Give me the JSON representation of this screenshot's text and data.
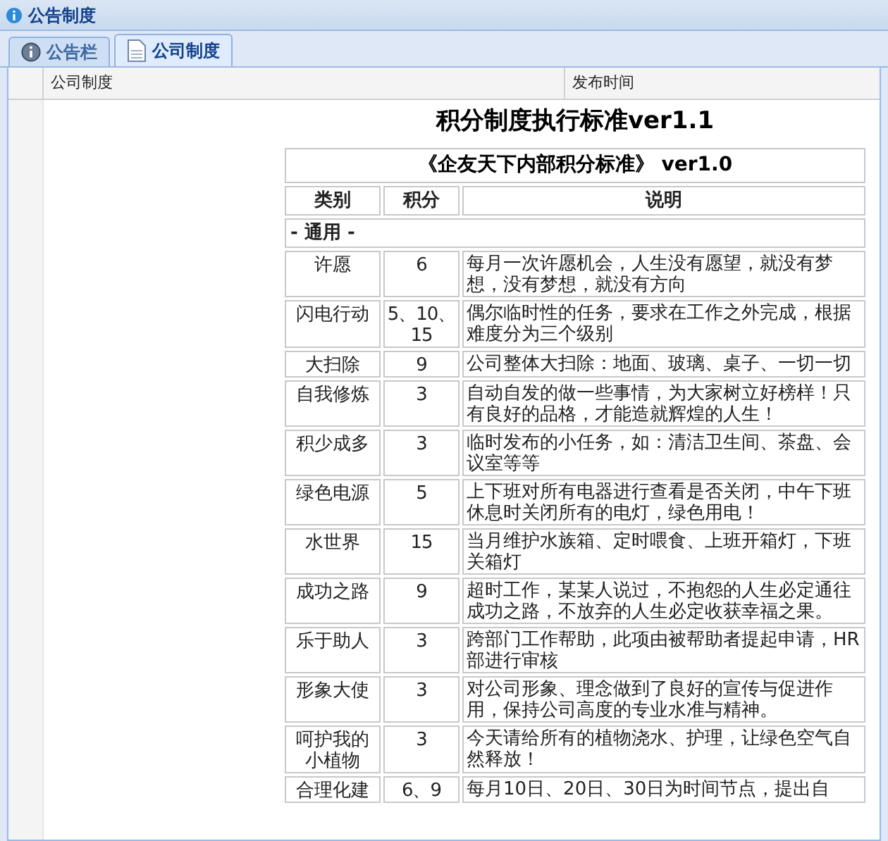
{
  "window": {
    "title": "公告制度"
  },
  "tabs": [
    {
      "label": "公告栏",
      "selected": false
    },
    {
      "label": "公司制度",
      "selected": true
    }
  ],
  "grid": {
    "columns": [
      "公司制度",
      "发布时间"
    ]
  },
  "document": {
    "title": "积分制度执行标准ver1.1",
    "subtitle": "《企友天下内部积分标准》 ver1.0",
    "columns": [
      "类别",
      "积分",
      "说明"
    ],
    "sections": [
      {
        "name": "- 通用 -",
        "rows": [
          {
            "category": "许愿",
            "points": "6",
            "description": "每月一次许愿机会，人生没有愿望，就没有梦想，没有梦想，就没有方向"
          },
          {
            "category": "闪电行动",
            "points": "5、10、15",
            "description": "偶尔临时性的任务，要求在工作之外完成，根据难度分为三个级别"
          },
          {
            "category": "大扫除",
            "points": "9",
            "description": "公司整体大扫除：地面、玻璃、桌子、一切一切"
          },
          {
            "category": "自我修炼",
            "points": "3",
            "description": "自动自发的做一些事情，为大家树立好榜样！只有良好的品格，才能造就辉煌的人生！"
          },
          {
            "category": "积少成多",
            "points": "3",
            "description": "临时发布的小任务，如：清洁卫生间、茶盘、会议室等等"
          },
          {
            "category": "绿色电源",
            "points": "5",
            "description": "上下班对所有电器进行查看是否关闭，中午下班休息时关闭所有的电灯，绿色用电！"
          },
          {
            "category": "水世界",
            "points": "15",
            "description": "当月维护水族箱、定时喂食、上班开箱灯，下班关箱灯"
          },
          {
            "category": "成功之路",
            "points": "9",
            "description": "超时工作，某某人说过，不抱怨的人生必定通往成功之路，不放弃的人生必定收获幸福之果。"
          },
          {
            "category": "乐于助人",
            "points": "3",
            "description": "跨部门工作帮助，此项由被帮助者提起申请，HR部进行审核"
          },
          {
            "category": "形象大使",
            "points": "3",
            "description": "对公司形象、理念做到了良好的宣传与促进作用，保持公司高度的专业水准与精神。"
          },
          {
            "category": "呵护我的小植物",
            "points": "3",
            "description": "今天请给所有的植物浇水、护理，让绿色空气自然释放！"
          },
          {
            "category": "合理化建",
            "points": "6、9",
            "description": "每月10日、20日、30日为时间节点，提出自"
          }
        ]
      }
    ]
  }
}
